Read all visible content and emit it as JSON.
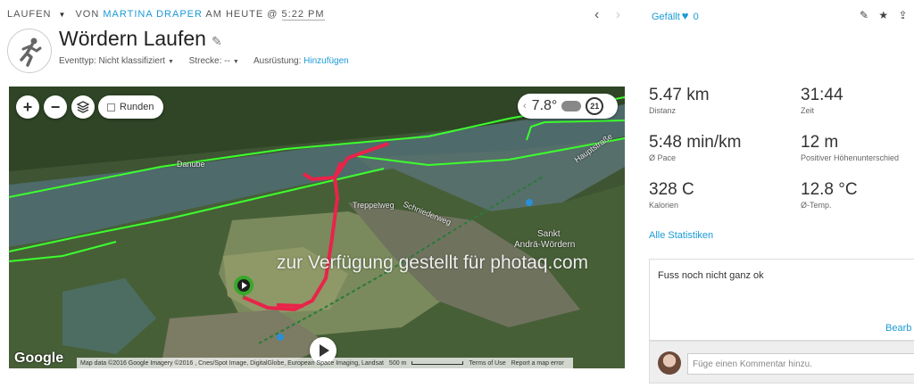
{
  "header": {
    "activity_type": "LAUFEN",
    "by_label": "VON",
    "athlete": "MARTINA DRAPER",
    "at_label": "AM HEUTE @",
    "time": "5:22 PM",
    "prev_icon": "chevron-left-icon",
    "next_icon": "chevron-right-icon"
  },
  "activity": {
    "title": "Wördern Laufen",
    "icon": "runner-icon",
    "event_type_label": "Eventtyp:",
    "event_type_value": "Nicht klassifiziert",
    "course_label": "Strecke:",
    "course_value": "--",
    "gear_label": "Ausrüstung:",
    "gear_value": "Hinzufügen"
  },
  "map": {
    "zoom_in": "+",
    "zoom_out": "−",
    "laps_label": "Runden",
    "weather_temp": "7.8°",
    "weather_icon": "cloud-icon",
    "timer_value": "21",
    "labels": {
      "river": "Danube",
      "street1": "Treppelweg",
      "street2": "Schniederweg",
      "street3": "Hauptstraße",
      "town_line1": "Sankt",
      "town_line2": "Andrä-Wördern"
    },
    "watermark": "zur Verfügung gestellt für photaq.com",
    "provider": "Google",
    "attribution": "Map data ©2016 Google Imagery ©2016 , Cnes/Spot Image, DigitalGlobe, European Space Imaging, Landsat",
    "scale": "500 m",
    "terms": "Terms of Use",
    "report": "Report a map error"
  },
  "social": {
    "likes_label": "Gefällt",
    "likes_count": "0"
  },
  "stats": [
    {
      "value": "5.47 km",
      "label": "Distanz"
    },
    {
      "value": "31:44",
      "label": "Zeit"
    },
    {
      "value": "5:48 min/km",
      "label": "Ø Pace"
    },
    {
      "value": "12 m",
      "label": "Positiver Höhenunterschied"
    },
    {
      "value": "328 C",
      "label": "Kalorien"
    },
    {
      "value": "12.8 °C",
      "label": "Ø-Temp."
    }
  ],
  "all_stats_link": "Alle Statistiken",
  "note": {
    "text": "Fuss noch nicht ganz ok",
    "edit_label": "Bearb"
  },
  "comment": {
    "placeholder": "Füge einen Kommentar hinzu."
  }
}
